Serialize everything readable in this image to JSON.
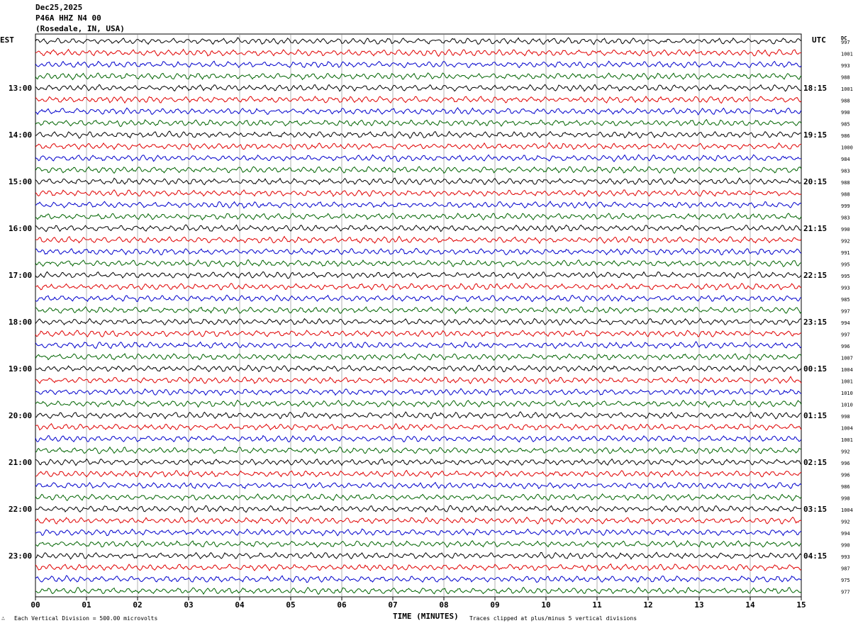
{
  "header": {
    "date": "Dec25,2025",
    "station": "P46A HHZ N4 00",
    "location": "(Rosedale, IN, USA)"
  },
  "left_zone": "EST",
  "right_zone": "UTC",
  "dc_label": "DC",
  "footer": {
    "scale_note": "Each Vertical Division =  500.00 microvolts",
    "clip_note": "Traces clipped at plus/minus 5 vertical divisions",
    "corner_mark": "∴"
  },
  "colors": {
    "trace_cycle": [
      "#000000",
      "#e00000",
      "#0000cc",
      "#006400"
    ],
    "grid": "#808080"
  },
  "chart_data": {
    "type": "line",
    "title": "",
    "xlabel": "TIME (MINUTES)",
    "xlim": [
      0,
      15
    ],
    "x_ticks": [
      "00",
      "01",
      "02",
      "03",
      "04",
      "05",
      "06",
      "07",
      "08",
      "09",
      "10",
      "11",
      "12",
      "13",
      "14",
      "15"
    ],
    "est_hour_labels": [
      "13:00",
      "14:00",
      "15:00",
      "16:00",
      "17:00",
      "18:00",
      "19:00",
      "20:00",
      "21:00",
      "22:00",
      "23:00"
    ],
    "utc_hour_labels": [
      "18:15",
      "19:15",
      "20:15",
      "21:15",
      "22:15",
      "23:15",
      "00:15",
      "01:15",
      "02:15",
      "03:15",
      "04:15"
    ],
    "first_labeled_trace_index": 4,
    "dc_offsets": [
      997,
      1001,
      993,
      988,
      1001,
      988,
      990,
      985,
      986,
      1000,
      984,
      983,
      988,
      988,
      999,
      983,
      990,
      992,
      991,
      995,
      995,
      993,
      985,
      997,
      994,
      997,
      996,
      1007,
      1004,
      1001,
      1010,
      1010,
      998,
      1004,
      1001,
      992,
      996,
      996,
      986,
      998,
      1004,
      992,
      994,
      990,
      993,
      987,
      975,
      977
    ],
    "grid": true
  }
}
